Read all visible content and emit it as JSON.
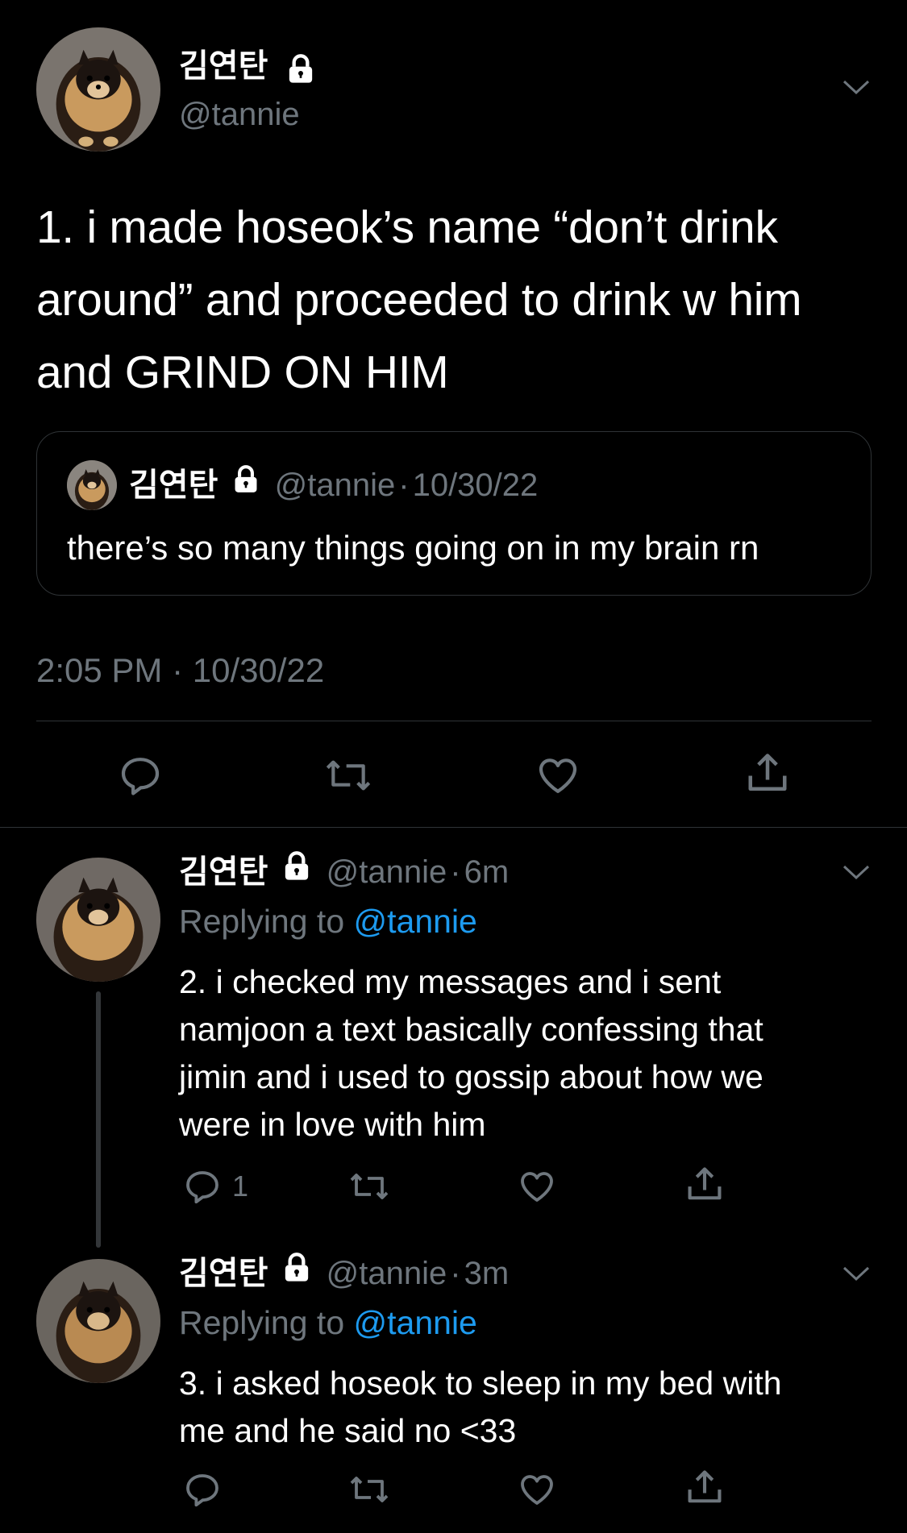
{
  "main_tweet": {
    "display_name": "김연탄",
    "handle": "@tannie",
    "text_line1": "1. i made hoseok’s name “don’t drink",
    "text_line2": "around” and proceeded to drink w him",
    "text_line3": "and GRIND ON HIM",
    "quote": {
      "display_name": "김연탄",
      "handle": "@tannie",
      "date": "10/30/22",
      "text": "there’s so many things going on in my brain rn"
    },
    "timestamp": "2:05 PM · 10/30/22"
  },
  "replies": [
    {
      "display_name": "김연탄",
      "handle": "@tannie",
      "time": "6m",
      "replying_prefix": "Replying to",
      "replying_to": "@tannie",
      "lines": [
        "2. i checked my messages and i sent",
        "namjoon a text basically confessing that",
        "jimin and i used to gossip about how we",
        "were in love with him"
      ],
      "reply_count": "1"
    },
    {
      "display_name": "김연탄",
      "handle": "@tannie",
      "time": "3m",
      "replying_prefix": "Replying to",
      "replying_to": "@tannie",
      "lines": [
        "3. i asked hoseok to sleep in my bed with",
        "me and he said no <33"
      ],
      "reply_count": ""
    }
  ],
  "separator": "·",
  "icons": {
    "lock": "lock-icon",
    "more": "chevron-down-icon",
    "reply": "reply-icon",
    "retweet": "retweet-icon",
    "like": "heart-icon",
    "share": "share-icon"
  },
  "colors": {
    "background": "#000000",
    "text": "#ffffff",
    "muted": "#6e767d",
    "accent": "#1d9bf0",
    "border": "#2f3336"
  }
}
